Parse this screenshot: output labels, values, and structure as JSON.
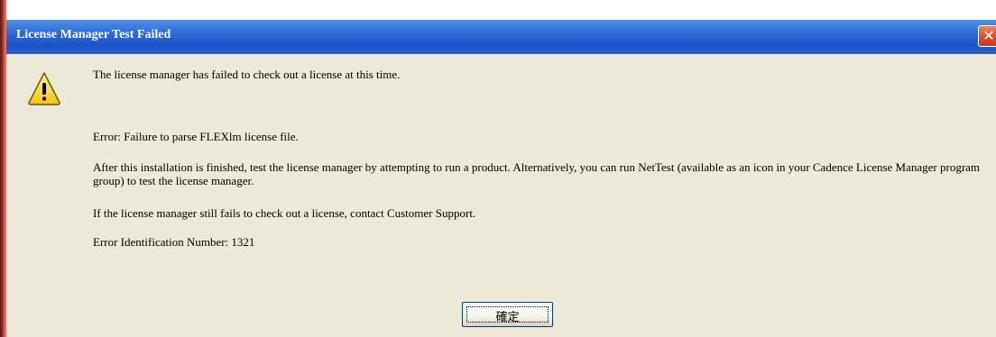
{
  "dialog": {
    "title": "License Manager Test Failed",
    "close_symbol": "✕",
    "icon": "warning-icon",
    "messages": {
      "line1": "The license manager has failed to check out a license at this time.",
      "error": "Error: Failure to parse FLEXlm license file.",
      "after_install": "After this installation is finished, test the license manager by attempting to run a product. Alternatively, you can run NetTest (available as an icon in your Cadence License Manager program group) to test the license manager.",
      "still_fails": "If the license manager still fails to check out a license, contact Customer Support.",
      "error_id": "Error Identification Number: 1321"
    },
    "ok_label": "確定"
  },
  "colors": {
    "titlebar": "#1d54c8",
    "face": "#ece9d8",
    "close": "#d4502f"
  }
}
